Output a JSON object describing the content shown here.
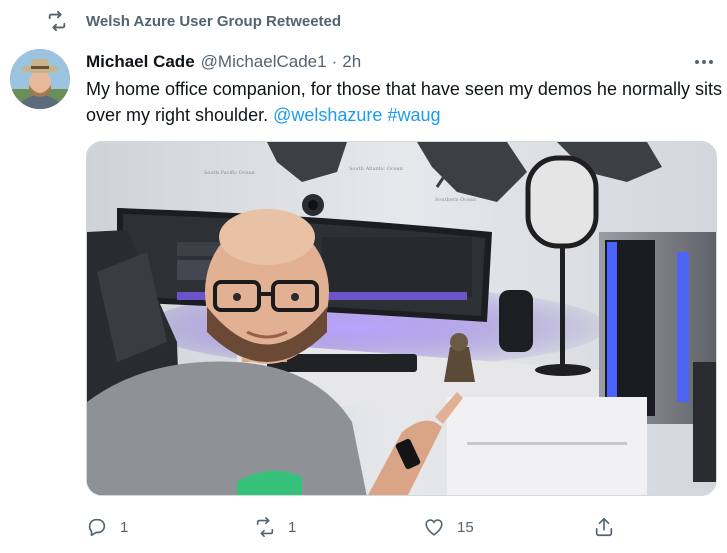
{
  "retweet": {
    "icon": "retweet-icon",
    "label": "Welsh Azure User Group Retweeted"
  },
  "tweet": {
    "author_name": "Michael Cade",
    "author_handle": "@MichaelCade1",
    "separator": "·",
    "timestamp": "2h",
    "text": "My home office companion, for those that have seen my demos he normally sits over my right shoulder.",
    "mentions": [
      "@welshazure",
      "#waug"
    ],
    "more_icon": "more-horizontal-icon"
  },
  "media": {
    "icon": "photo-image",
    "map_labels": [
      "South Pacific Ocean",
      "South Atlantic Ocean",
      "Southern Ocean"
    ]
  },
  "actions": {
    "reply": {
      "icon": "reply-icon",
      "count": "1"
    },
    "retweet": {
      "icon": "retweet-icon",
      "count": "1"
    },
    "like": {
      "icon": "heart-icon",
      "count": "15"
    },
    "share": {
      "icon": "share-icon",
      "count": ""
    }
  },
  "colors": {
    "primary_text": "#0f1419",
    "secondary_text": "#536471",
    "link": "#1d9bf0",
    "border": "#cfd9de"
  }
}
